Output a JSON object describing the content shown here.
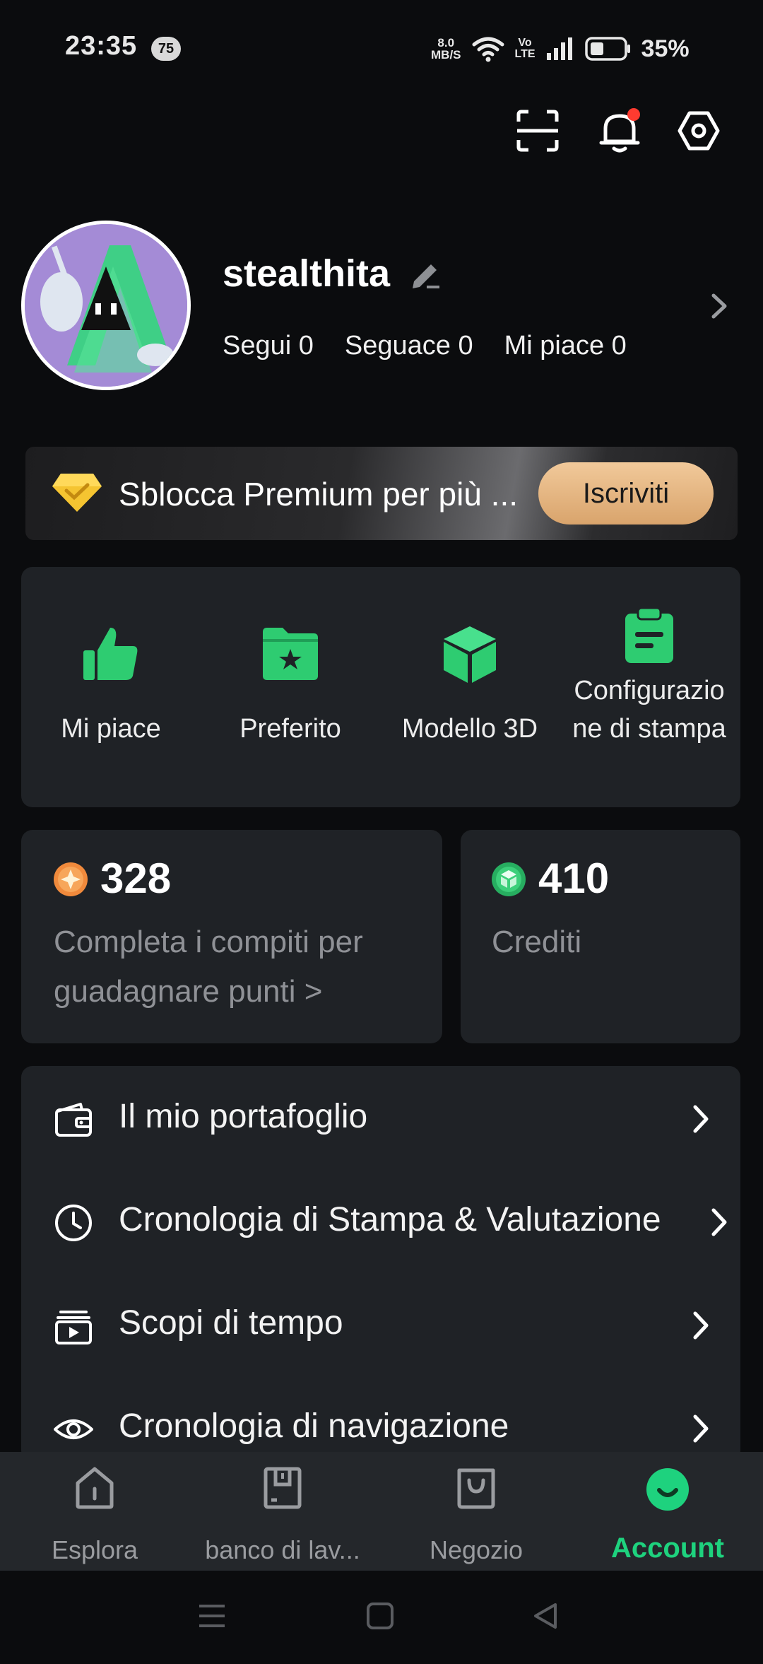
{
  "status_bar": {
    "time": "23:35",
    "notification_count": "75",
    "net_speed_top": "8.0",
    "net_speed_bottom": "MB/S",
    "volte_top": "Vo",
    "volte_bottom": "LTE",
    "battery_percent": "35%"
  },
  "top_actions": {
    "icons": [
      "scan-icon",
      "bell-icon",
      "settings-hex-icon"
    ],
    "has_notification_dot": true
  },
  "profile": {
    "username": "stealthita",
    "stats": {
      "following": "Segui 0",
      "followers": "Seguace 0",
      "likes": "Mi piace 0"
    }
  },
  "premium": {
    "text": "Sblocca Premium per più ...",
    "button_label": "Iscriviti"
  },
  "quick_actions": [
    {
      "icon": "thumbs-up-icon",
      "label": "Mi piace"
    },
    {
      "icon": "folder-star-icon",
      "label": "Preferito"
    },
    {
      "icon": "cube-icon",
      "label": "Modello 3D"
    },
    {
      "icon": "clipboard-icon",
      "label_line1": "Configurazio",
      "label_line2": "ne di stampa"
    }
  ],
  "points": {
    "value": "328",
    "text_line1": "Completa i compiti per",
    "text_line2": "guadagnare punti >"
  },
  "credits": {
    "value": "410",
    "label": "Crediti"
  },
  "menu": [
    {
      "icon": "wallet-icon",
      "label": "Il mio portafoglio"
    },
    {
      "icon": "clock-icon",
      "label": "Cronologia di Stampa & Valutazione"
    },
    {
      "icon": "timelapse-icon",
      "label": "Scopi di tempo"
    },
    {
      "icon": "eye-icon",
      "label": "Cronologia di navigazione"
    }
  ],
  "bottom_nav": [
    {
      "icon": "home-icon",
      "label": "Esplora"
    },
    {
      "icon": "workbench-icon",
      "label": "banco di lav..."
    },
    {
      "icon": "shop-bag-icon",
      "label": "Negozio"
    },
    {
      "icon": "account-smile-icon",
      "label": "Account",
      "active": true
    }
  ],
  "colors": {
    "accent": "#1ed27e",
    "background": "#0b0c0e",
    "card": "#1f2226",
    "premium_button": "#e8b784",
    "notification_dot": "#ff3b30"
  }
}
